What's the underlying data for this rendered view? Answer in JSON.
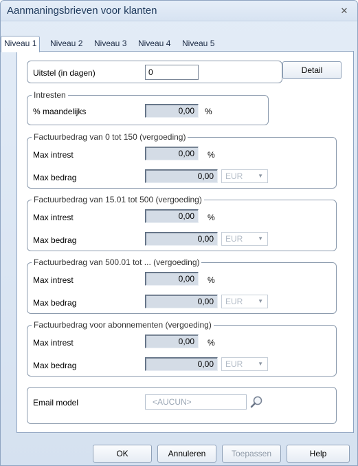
{
  "window": {
    "title": "Aanmaningsbrieven voor klanten"
  },
  "tabs": [
    "Niveau 1",
    "Niveau 2",
    "Niveau 3",
    "Niveau 4",
    "Niveau 5"
  ],
  "uitstel": {
    "label": "Uitstel (in dagen)",
    "value": "0"
  },
  "detail_button": "Detail",
  "intresten": {
    "legend": "Intresten",
    "label": "% maandelijks",
    "value": "0,00",
    "unit": "%"
  },
  "groups": [
    {
      "legend": "Factuurbedrag van 0 tot 150 (vergoeding)",
      "max_intrest_label": "Max intrest",
      "max_intrest_value": "0,00",
      "max_intrest_unit": "%",
      "max_bedrag_label": "Max bedrag",
      "max_bedrag_value": "0,00",
      "currency": "EUR"
    },
    {
      "legend": "Factuurbedrag van 15.01 tot 500 (vergoeding)",
      "max_intrest_label": "Max intrest",
      "max_intrest_value": "0,00",
      "max_intrest_unit": "%",
      "max_bedrag_label": "Max bedrag",
      "max_bedrag_value": "0,00",
      "currency": "EUR"
    },
    {
      "legend": "Factuurbedrag van 500.01 tot ... (vergoeding)",
      "max_intrest_label": "Max intrest",
      "max_intrest_value": "0,00",
      "max_intrest_unit": "%",
      "max_bedrag_label": "Max bedrag",
      "max_bedrag_value": "0,00",
      "currency": "EUR"
    },
    {
      "legend": "Factuurbedrag voor abonnementen (vergoeding)",
      "max_intrest_label": "Max intrest",
      "max_intrest_value": "0,00",
      "max_intrest_unit": "%",
      "max_bedrag_label": "Max bedrag",
      "max_bedrag_value": "0,00",
      "currency": "EUR"
    }
  ],
  "email_model": {
    "label": "Email model",
    "value": "<AUCUN>"
  },
  "footer": {
    "ok": "OK",
    "annuleren": "Annuleren",
    "toepassen": "Toepassen",
    "help": "Help"
  },
  "icons": {
    "close": "close-icon",
    "search": "search-icon",
    "dropdown": "chevron-down-icon"
  }
}
